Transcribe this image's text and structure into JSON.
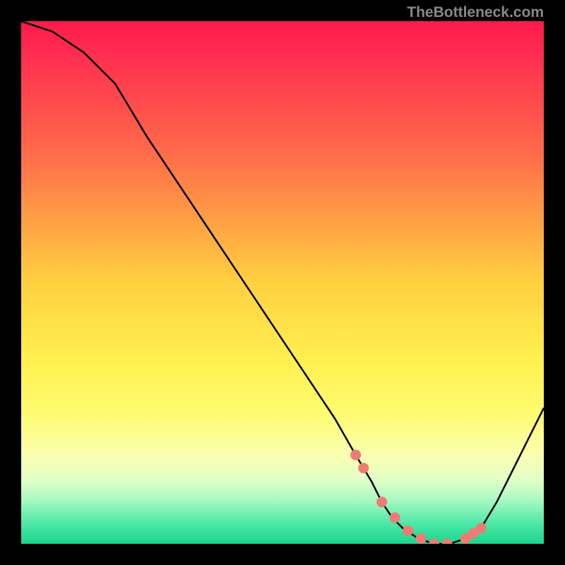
{
  "branding": {
    "text": "TheBottleneck.com"
  },
  "chart_data": {
    "type": "line",
    "title": "",
    "xlabel": "",
    "ylabel": "",
    "xlim": [
      0,
      100
    ],
    "ylim": [
      0,
      100
    ],
    "gradient_stops": [
      {
        "offset": 0.0,
        "color": "#ff1a4c"
      },
      {
        "offset": 0.05,
        "color": "#ff2950"
      },
      {
        "offset": 0.25,
        "color": "#ff6a4a"
      },
      {
        "offset": 0.5,
        "color": "#ffd040"
      },
      {
        "offset": 0.65,
        "color": "#fff050"
      },
      {
        "offset": 0.75,
        "color": "#fffc70"
      },
      {
        "offset": 0.83,
        "color": "#faffb0"
      },
      {
        "offset": 0.88,
        "color": "#e0ffc8"
      },
      {
        "offset": 0.92,
        "color": "#a0f8c0"
      },
      {
        "offset": 0.96,
        "color": "#50e8a8"
      },
      {
        "offset": 1.0,
        "color": "#18d68c"
      }
    ],
    "series": [
      {
        "name": "bottleneck-curve",
        "x": [
          0,
          6,
          12,
          18,
          24,
          30,
          36,
          42,
          48,
          54,
          60,
          64,
          67,
          69,
          71,
          73,
          76,
          79,
          82,
          85,
          88,
          91,
          94,
          97,
          100
        ],
        "values": [
          100,
          98,
          94,
          88,
          78,
          69,
          60,
          51,
          42,
          33,
          24,
          17,
          12,
          8,
          5,
          3,
          1,
          0,
          0,
          1,
          3,
          8,
          14,
          20,
          26
        ]
      }
    ],
    "markers": {
      "name": "optimal-range-markers",
      "x": [
        64,
        65.5,
        69,
        71.5,
        74,
        76.5,
        79,
        81.5,
        85,
        86.5,
        88
      ],
      "values": [
        17,
        14.5,
        8,
        5,
        2.5,
        1,
        0,
        0,
        1,
        2.0,
        3
      ]
    }
  }
}
